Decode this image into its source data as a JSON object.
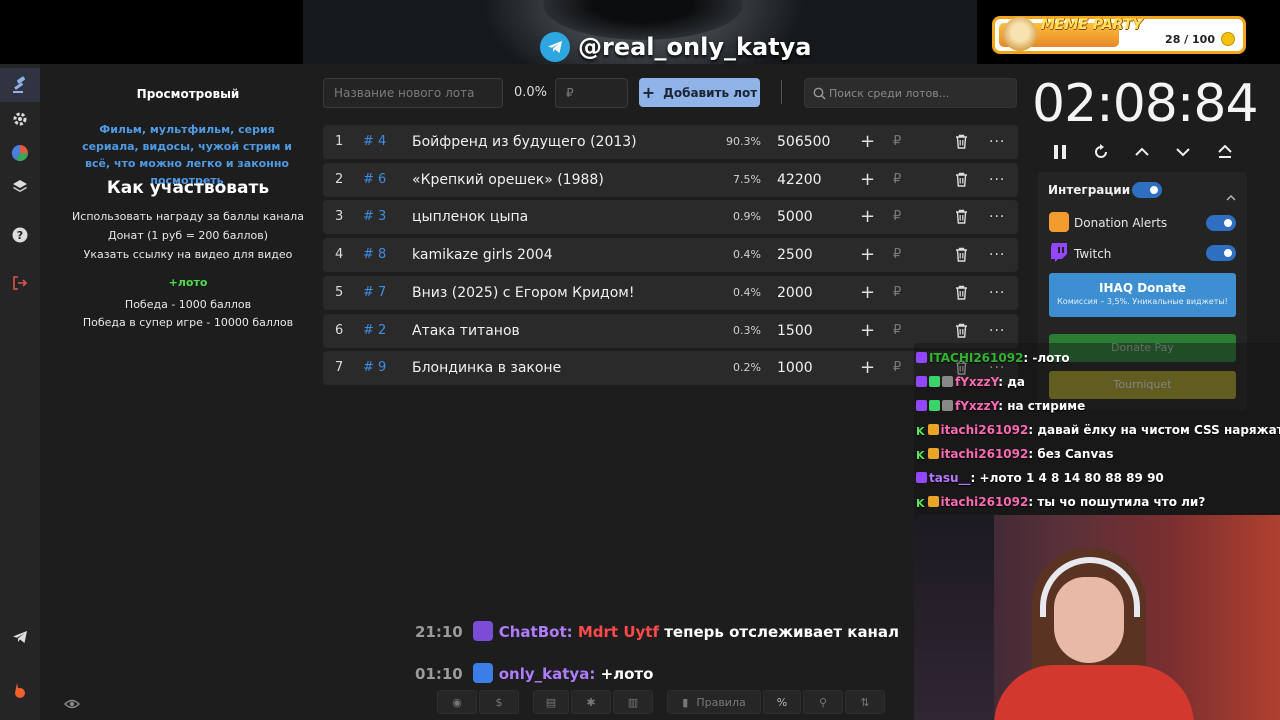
{
  "banner": {
    "telegram_handle": "@real_only_katya"
  },
  "meme_party": {
    "title": "MEME PARTY",
    "count": "28 / 100"
  },
  "rules": {
    "viewing": "Просмотровый",
    "allowed": "Фильм, мультфильм, серия сериала, видосы, чужой стрим и всё, что можно легко и законно посмотреть",
    "how_title": "Как участвовать",
    "ways": [
      "Использовать награду за баллы канала",
      "Донат (1 руб = 200 баллов)",
      "Указать ссылку на видео для видео"
    ],
    "lotto": "+лото",
    "prizes": [
      "Победа - 1000 баллов",
      "Победа в супер игре - 10000 баллов"
    ]
  },
  "toolbar": {
    "new_lot_placeholder": "Название нового лота",
    "percent": "0.0%",
    "amount_placeholder": "₽",
    "add_label": "Добавить лот",
    "search_placeholder": "Поиск среди лотов..."
  },
  "lots": [
    {
      "idx": "1",
      "id": "# 4",
      "name": "Бойфренд из будущего (2013)",
      "pct": "90.3%",
      "amount": "506500"
    },
    {
      "idx": "2",
      "id": "# 6",
      "name": "«Крепкий орешек» (1988)",
      "pct": "7.5%",
      "amount": "42200"
    },
    {
      "idx": "3",
      "id": "# 3",
      "name": "цыпленок цыпа",
      "pct": "0.9%",
      "amount": "5000"
    },
    {
      "idx": "4",
      "id": "# 8",
      "name": "kamikaze girls 2004",
      "pct": "0.4%",
      "amount": "2500"
    },
    {
      "idx": "5",
      "id": "# 7",
      "name": "Вниз (2025) с Егором Кридом!",
      "pct": "0.4%",
      "amount": "2000"
    },
    {
      "idx": "6",
      "id": "# 2",
      "name": "Атака титанов",
      "pct": "0.3%",
      "amount": "1500"
    },
    {
      "idx": "7",
      "id": "# 9",
      "name": "Блондинка в законе",
      "pct": "0.2%",
      "amount": "1000"
    }
  ],
  "lot_controls": {
    "plus": "+",
    "currency": "₽",
    "more": "···"
  },
  "timer": {
    "value": "02:08:84"
  },
  "integrations": {
    "title": "Интеграции",
    "items": [
      "Donation Alerts",
      "Twitch"
    ],
    "ihaq": {
      "label": "IHAQ Donate",
      "sub": "Комиссия – 3,5%. Уникальные виджеты!"
    },
    "donatepay": "Donate Pay",
    "tourniquet": "Tourniquet"
  },
  "twitch_chat": [
    {
      "nick": "ITACHI261092",
      "text": ": -лото"
    },
    {
      "nick": "fYxzzY",
      "text": ": да"
    },
    {
      "nick": "fYxzzY",
      "text": ": на стириме"
    },
    {
      "nick": "itachi261092",
      "text": ": давай ёлку на чистом CSS наряжать?"
    },
    {
      "nick": "itachi261092",
      "text": ": без Canvas"
    },
    {
      "nick": "tasu__",
      "text": ": +лото 1 4 8 14 80 88 89 90"
    },
    {
      "nick": "itachi261092",
      "text": ": ты чо пошутила что ли?"
    }
  ],
  "badges": {
    "k": "K"
  },
  "overlay_messages": [
    {
      "time": "21:10",
      "nick": "ChatBot:",
      "target": "Mdrt Uytf",
      "text": "теперь отслеживает канал"
    },
    {
      "time": "01:10",
      "nick": "only_katya:",
      "text": "+лото"
    }
  ],
  "bottom_bar": {
    "rules_label": "Правила",
    "percent_label": "%"
  },
  "colors": {
    "accent": "#90b4e8",
    "link": "#3e8de3",
    "lotto": "#4ddc4d"
  }
}
